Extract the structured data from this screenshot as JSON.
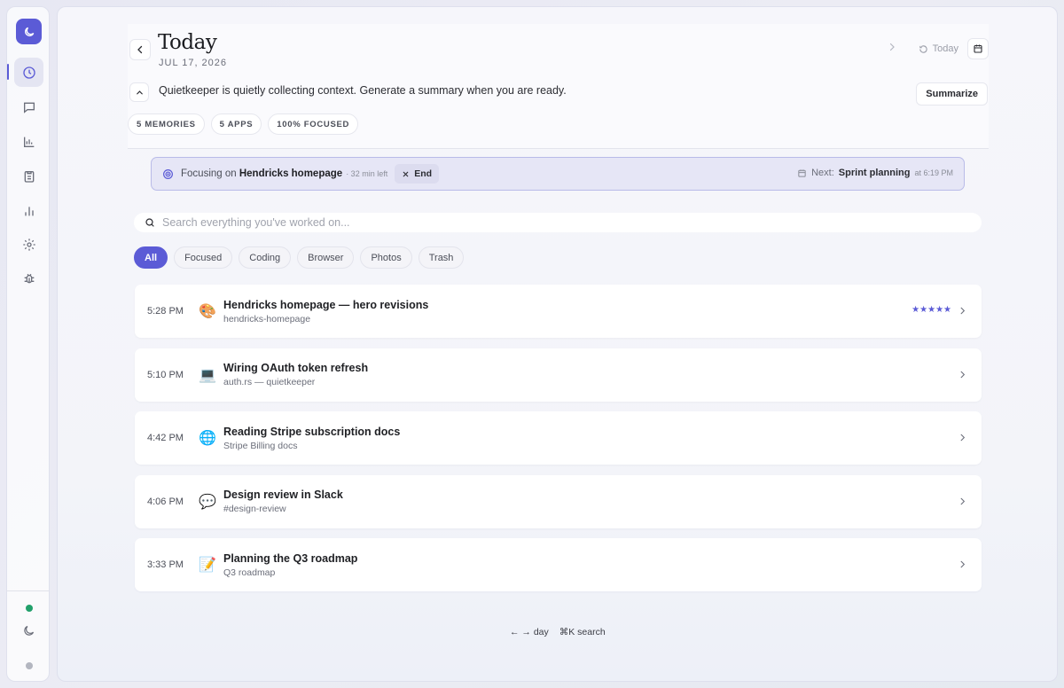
{
  "header": {
    "title": "Today",
    "date": "JUL 17, 2026",
    "today_label": "Today",
    "context_text": "Quietkeeper is quietly collecting context. Generate a summary when you are ready.",
    "summarize_label": "Summarize",
    "chips": [
      "5 MEMORIES",
      "5 APPS",
      "100% FOCUSED"
    ]
  },
  "focus": {
    "prefix": "Focusing on",
    "target": "Hendricks homepage",
    "time_left": "· 32 min left",
    "end_label": "End",
    "next_prefix": "Next:",
    "next_title": "Sprint planning",
    "next_time": "at 6:19 PM"
  },
  "search": {
    "placeholder": "Search everything you've worked on..."
  },
  "filters": [
    "All",
    "Focused",
    "Coding",
    "Browser",
    "Photos",
    "Trash"
  ],
  "items": [
    {
      "time": "5:28 PM",
      "emoji": "🎨",
      "title": "Hendricks homepage — hero revisions",
      "subtitle": "hendricks-homepage",
      "stars": "★★★★★"
    },
    {
      "time": "5:10 PM",
      "emoji": "💻",
      "title": "Wiring OAuth token refresh",
      "subtitle": "auth.rs — quietkeeper"
    },
    {
      "time": "4:42 PM",
      "emoji": "🌐",
      "title": "Reading Stripe subscription docs",
      "subtitle": "Stripe Billing docs"
    },
    {
      "time": "4:06 PM",
      "emoji": "💬",
      "title": "Design review in Slack",
      "subtitle": "#design-review"
    },
    {
      "time": "3:33 PM",
      "emoji": "📝",
      "title": "Planning the Q3 roadmap",
      "subtitle": "Q3 roadmap"
    }
  ],
  "footer": {
    "day_hint": "← → day",
    "search_hint": "⌘K search"
  },
  "colors": {
    "accent": "#5b5bd6",
    "status_online": "#22a06b"
  }
}
